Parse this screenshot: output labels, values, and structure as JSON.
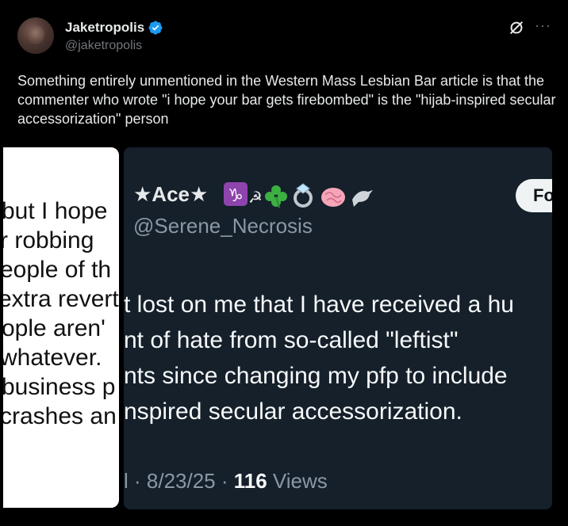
{
  "tweet": {
    "author_name": "Jaketropolis",
    "author_handle": "@jaketropolis",
    "text": "Something entirely unmentioned in the Western Mass Lesbian Bar article is that the commenter who wrote \"i hope your bar gets firebombed\" is the \"hijab-inspired secular accessorization\" person",
    "icons": [
      "verified-badge-icon",
      "grok-icon",
      "more-icon"
    ],
    "accent_color": "#1d9bf0"
  },
  "left_image": {
    "lines": [
      "but I hope",
      "r robbing",
      "eople of th",
      "extra revert",
      "ople aren'",
      "whatever.",
      "business p",
      "crashes an"
    ]
  },
  "quoted_screenshot": {
    "display_name": "★Ace★",
    "emojis": [
      "capricorn",
      "hammer-sickle",
      "shamrock",
      "ring",
      "brain",
      "bird"
    ],
    "handle": "@Serene_Necrosis",
    "follow_label": "Fo",
    "body_lines": [
      "t lost on me that I have received a hu",
      "nt of hate from so-called \"leftist\"",
      "nts since changing my pfp to include",
      "nspired secular accessorization."
    ],
    "meta_prefix": "l · 8/23/25 · ",
    "views_count": "116",
    "views_label": " Views",
    "background_color": "#15202b"
  }
}
